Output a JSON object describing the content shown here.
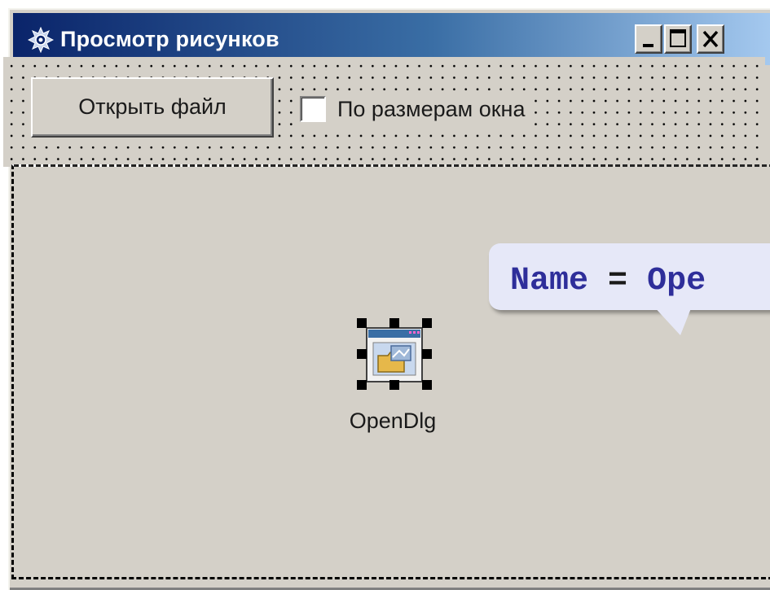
{
  "window": {
    "title": "Просмотр рисунков",
    "icon": "picture-viewer-app-icon",
    "caption_buttons": [
      "minimize",
      "maximize",
      "close"
    ]
  },
  "toolbar": {
    "open_button_label": "Открыть файл",
    "fit_checkbox_label": "По размерам окна",
    "fit_checkbox_checked": false
  },
  "component": {
    "label": "OpenDlg",
    "icon": "open-dialog-component-icon",
    "selected": true
  },
  "callout": {
    "keyword": "Name",
    "operator": "=",
    "value": "Ope"
  },
  "colors": {
    "title_gradient_start": "#0a246a",
    "title_gradient_end": "#a6caf0",
    "face": "#d4d0c8",
    "callout_background": "#e6e8f8",
    "callout_keyword": "#2e2e9a"
  }
}
